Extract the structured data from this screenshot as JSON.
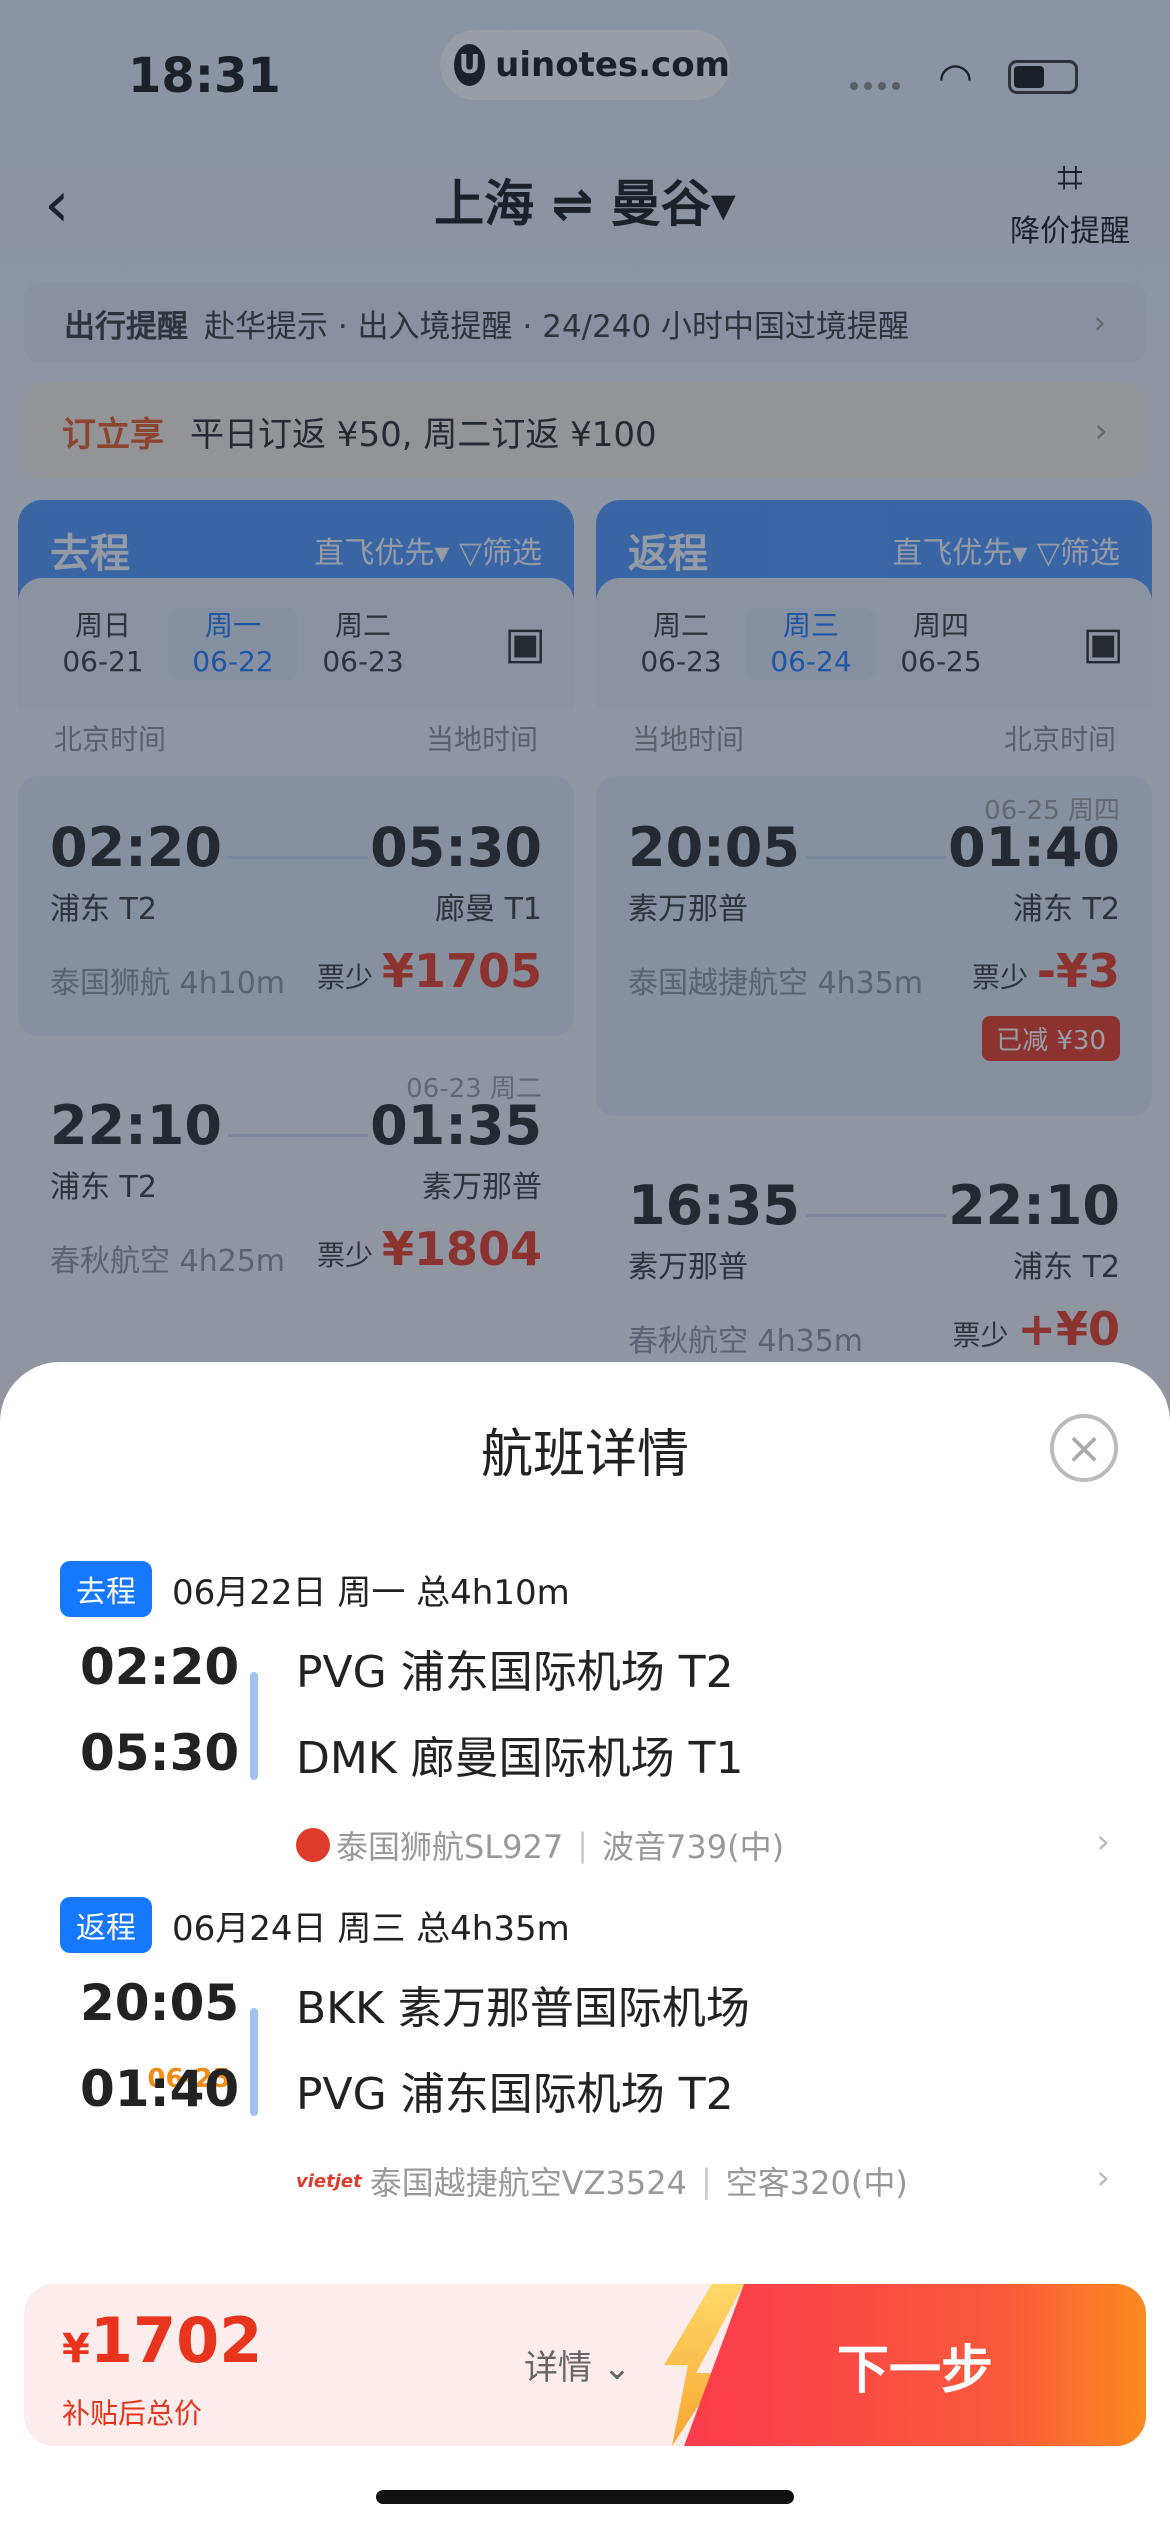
{
  "status_bar": {
    "time": "18:31",
    "watermark": "uinotes.com"
  },
  "nav": {
    "back": "‹",
    "route": "上海 ⇌ 曼谷▾",
    "alert_label": "降价提醒"
  },
  "notice": {
    "title": "出行提醒",
    "text": "赴华提示 · 出入境提醒 · 24/240 小时中国过境提醒"
  },
  "promo": {
    "tag": "订立享",
    "text": "平日订返 ¥50, 周二订返 ¥100"
  },
  "outbound": {
    "title": "去程",
    "options": "直飞优先▾  ▽筛选",
    "days": [
      {
        "week": "周日",
        "date": "06-21"
      },
      {
        "week": "周一",
        "date": "06-22"
      },
      {
        "week": "周二",
        "date": "06-23"
      }
    ],
    "tz_left": "北京时间",
    "tz_right": "当地时间",
    "flights": [
      {
        "dep": "02:20",
        "arr": "05:30",
        "dep_ap": "浦东 T2",
        "arr_ap": "廊曼 T1",
        "airline": "泰国狮航 4h10m",
        "price_label": "票少",
        "price": "¥1705",
        "next_day": ""
      },
      {
        "dep": "22:10",
        "arr": "01:35",
        "dep_ap": "浦东 T2",
        "arr_ap": "素万那普",
        "airline": "春秋航空 4h25m",
        "price_label": "票少",
        "price": "¥1804",
        "next_day": "06-23 周二"
      }
    ]
  },
  "return": {
    "title": "返程",
    "options": "直飞优先▾  ▽筛选",
    "days": [
      {
        "week": "周二",
        "date": "06-23"
      },
      {
        "week": "周三",
        "date": "06-24"
      },
      {
        "week": "周四",
        "date": "06-25"
      }
    ],
    "tz_left": "当地时间",
    "tz_right": "北京时间",
    "flights": [
      {
        "dep": "20:05",
        "arr": "01:40",
        "dep_ap": "素万那普",
        "arr_ap": "浦东 T2",
        "airline": "泰国越捷航空 4h35m",
        "price_label": "票少",
        "price": "-¥3",
        "next_day": "06-25 周四",
        "badge": "已减 ¥30"
      },
      {
        "dep": "16:35",
        "arr": "22:10",
        "dep_ap": "素万那普",
        "arr_ap": "浦东 T2",
        "airline": "春秋航空 4h35m",
        "price_label": "票少",
        "price": "+¥0",
        "next_day": ""
      }
    ]
  },
  "sheet": {
    "title": "航班详情",
    "segments": [
      {
        "tag": "去程",
        "summary": "06月22日 周一 总4h10m",
        "dep_time": "02:20",
        "arr_time": "05:30",
        "next_day": "",
        "dep_airport": "PVG 浦东国际机场 T2",
        "arr_airport": "DMK 廊曼国际机场 T1",
        "airline": "泰国狮航SL927",
        "aircraft": "波音739(中)"
      },
      {
        "tag": "返程",
        "summary": "06月24日 周三 总4h35m",
        "dep_time": "20:05",
        "arr_time": "01:40",
        "next_day": "06-25",
        "dep_airport": "BKK 素万那普国际机场",
        "arr_airport": "PVG 浦东国际机场 T2",
        "airline": "泰国越捷航空VZ3524",
        "aircraft": "空客320(中)"
      }
    ]
  },
  "footer": {
    "currency": "¥",
    "total": "1702",
    "total_label": "补贴后总价",
    "detail": "详情 ⌄",
    "next": "下一步"
  },
  "colors": {
    "primary": "#1677ff",
    "price_red": "#e8341c",
    "next_day_orange": "#f08c16"
  }
}
